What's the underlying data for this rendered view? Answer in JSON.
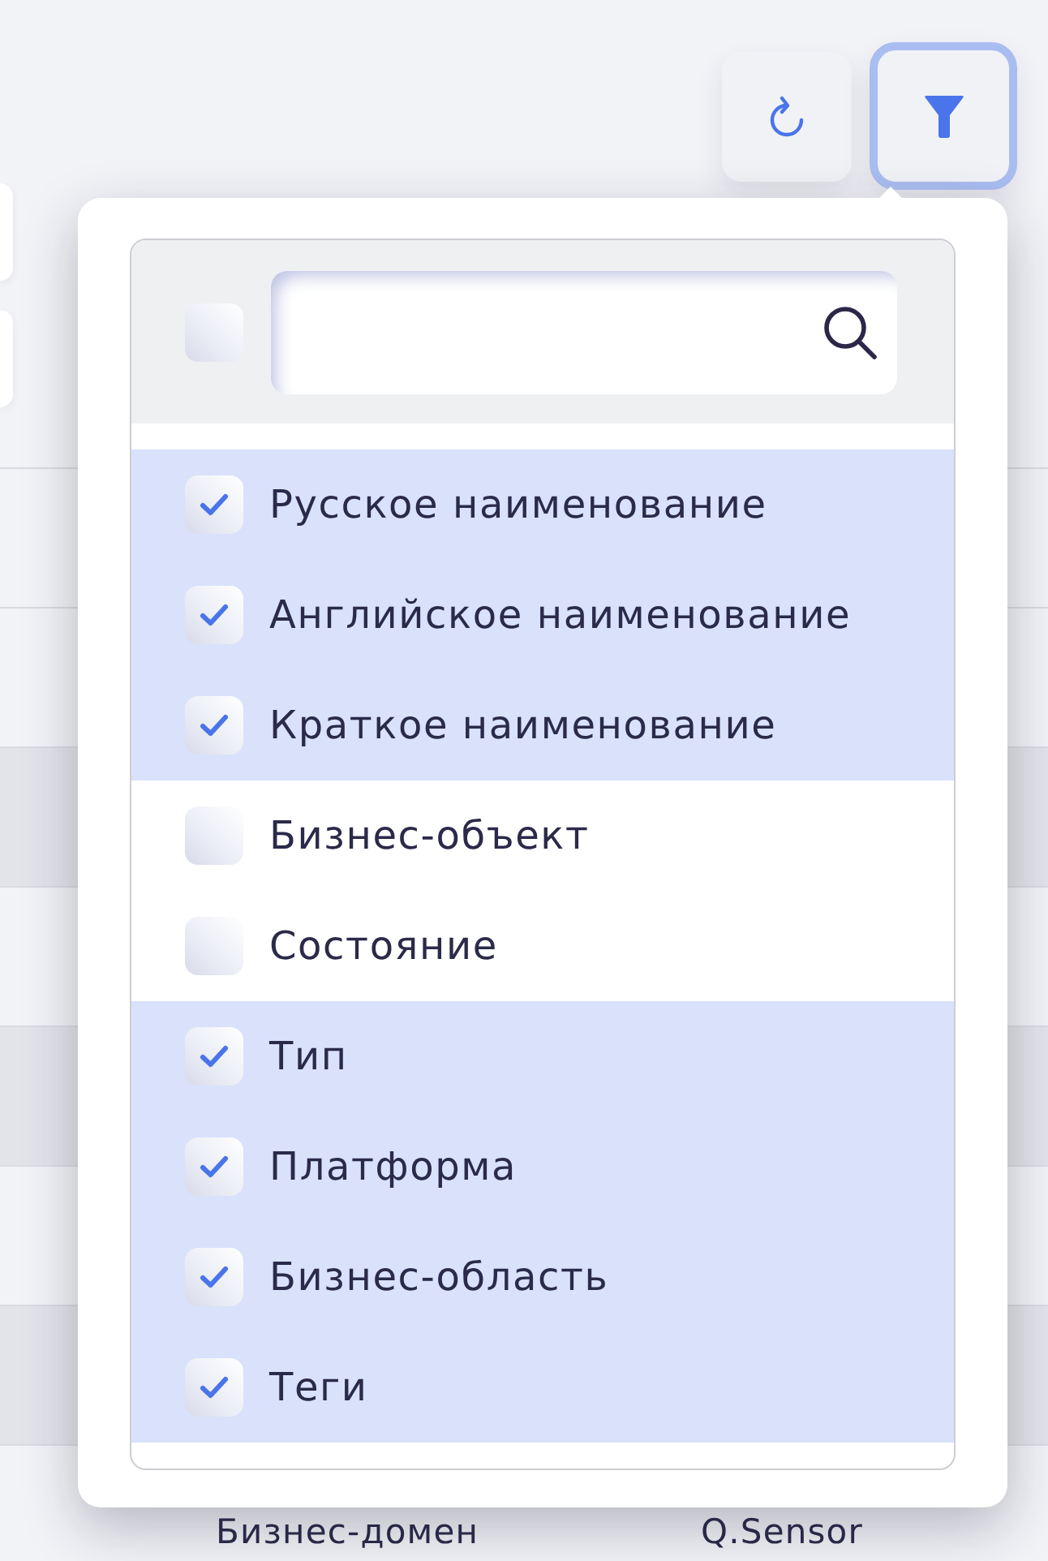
{
  "filter_button": {
    "active": true
  },
  "column_filter": {
    "select_all": {
      "checked": false
    },
    "columns": [
      {
        "label": "Русское наименование",
        "checked": true
      },
      {
        "label": "Английское наименование",
        "checked": true
      },
      {
        "label": "Краткое наименование",
        "checked": true
      },
      {
        "label": "Бизнес-объект",
        "checked": false
      },
      {
        "label": "Состояние",
        "checked": false
      },
      {
        "label": "Тип",
        "checked": true
      },
      {
        "label": "Платформа",
        "checked": true
      },
      {
        "label": "Бизнес-область",
        "checked": true
      },
      {
        "label": "Теги",
        "checked": true
      }
    ]
  },
  "table": {
    "rows": [
      {
        "cells": [
          "Бизнес-домен",
          "Q.Sensor"
        ]
      }
    ]
  }
}
